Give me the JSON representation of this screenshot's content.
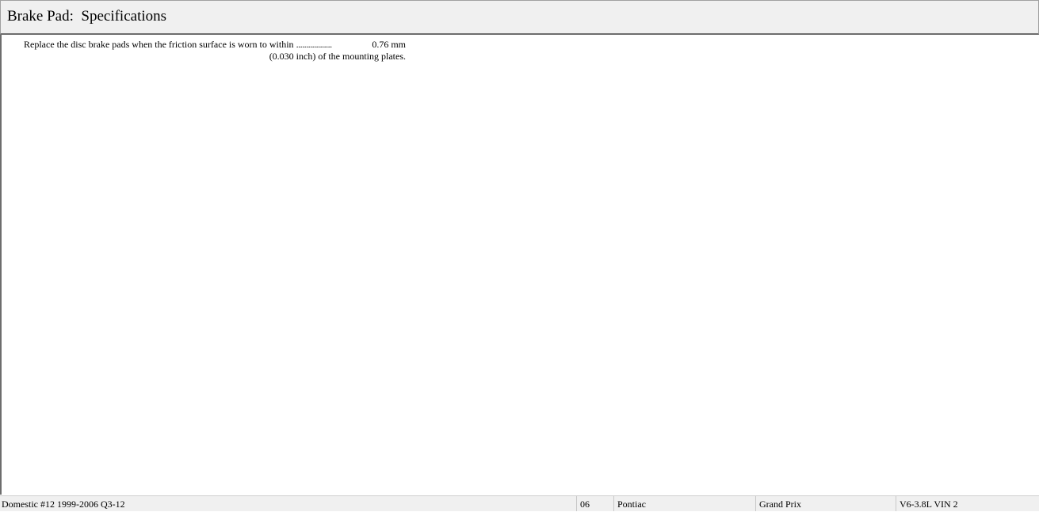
{
  "header": {
    "title": "Brake Pad:  Specifications"
  },
  "content": {
    "spec": {
      "label": "Replace the disc brake pads when the friction surface is worn to within",
      "dots": "..................",
      "value": "0.76 mm",
      "continuation": "(0.030 inch) of the mounting plates."
    }
  },
  "status_bar": {
    "database": "Domestic #12 1999-2006 Q3-12",
    "year": "06",
    "make": "Pontiac",
    "model": "Grand Prix",
    "engine": "V6-3.8L VIN 2"
  }
}
